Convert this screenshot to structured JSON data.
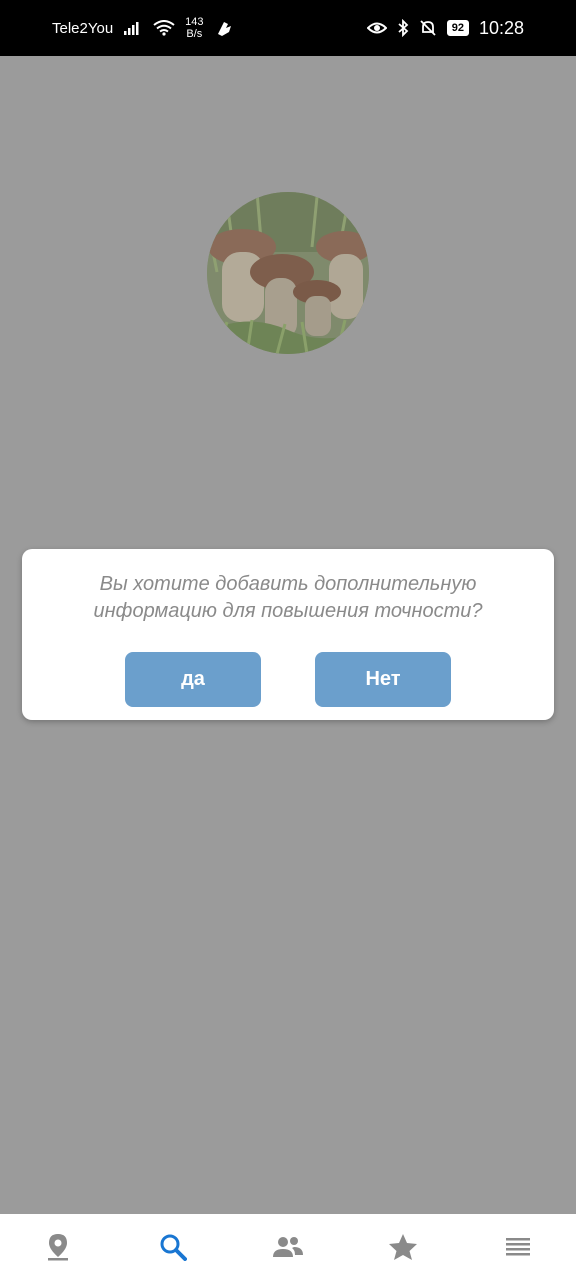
{
  "status_bar": {
    "carrier": "Tele2You",
    "speed_value": "143",
    "speed_unit": "B/s",
    "battery": "92",
    "time": "10:28"
  },
  "dialog": {
    "line1": "Вы хотите добавить дополнительную",
    "line2": "информацию для повышения точности?",
    "yes_label": "да",
    "no_label": "Нет"
  },
  "bottom_nav": {
    "items": [
      {
        "icon": "location-pin-icon",
        "active": false
      },
      {
        "icon": "search-icon",
        "active": true
      },
      {
        "icon": "people-icon",
        "active": false
      },
      {
        "icon": "star-icon",
        "active": false
      },
      {
        "icon": "menu-icon",
        "active": false
      }
    ],
    "active_color": "#1976d2",
    "inactive_color": "#8a8a8a"
  },
  "colors": {
    "overlay": "#9b9b9b",
    "button": "#6b9fcc"
  }
}
